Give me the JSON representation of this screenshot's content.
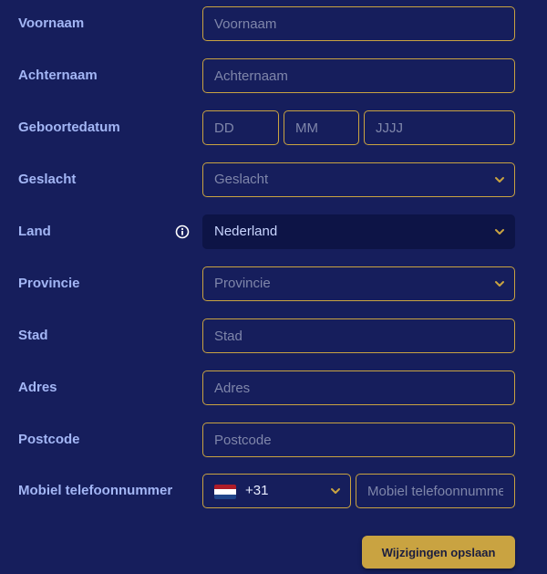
{
  "form": {
    "first_name": {
      "label": "Voornaam",
      "placeholder": "Voornaam"
    },
    "last_name": {
      "label": "Achternaam",
      "placeholder": "Achternaam"
    },
    "birthdate": {
      "label": "Geboortedatum",
      "day_placeholder": "DD",
      "month_placeholder": "MM",
      "year_placeholder": "JJJJ"
    },
    "gender": {
      "label": "Geslacht",
      "placeholder": "Geslacht"
    },
    "country": {
      "label": "Land",
      "value": "Nederland",
      "info_icon": "info-icon"
    },
    "province": {
      "label": "Provincie",
      "placeholder": "Provincie"
    },
    "city": {
      "label": "Stad",
      "placeholder": "Stad"
    },
    "address": {
      "label": "Adres",
      "placeholder": "Adres"
    },
    "postcode": {
      "label": "Postcode",
      "placeholder": "Postcode"
    },
    "mobile": {
      "label": "Mobiel telefoonnummer",
      "country_code": "+31",
      "flag": "netherlands-flag-icon",
      "placeholder": "Mobiel telefoonnummer"
    }
  },
  "actions": {
    "save_label": "Wijzigingen opslaan"
  },
  "colors": {
    "background": "#161e5c",
    "label": "#a3b6f5",
    "border_accent": "#c9a341",
    "placeholder": "#7f86aa",
    "selected_field_bg": "#0d1446",
    "button_bg": "#c9a341"
  }
}
